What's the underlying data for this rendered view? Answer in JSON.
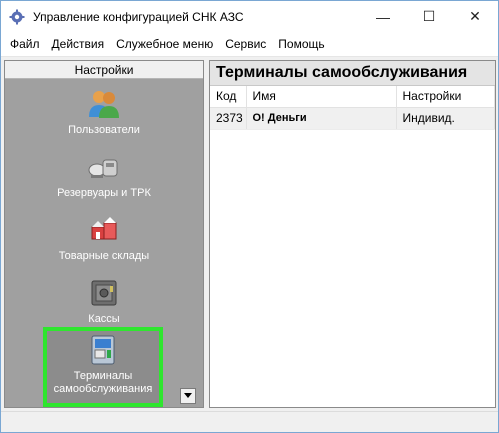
{
  "window": {
    "title": "Управление конфигурацией СНК АЗС",
    "controls": {
      "minimize": "—",
      "maximize": "☐",
      "close": "✕"
    }
  },
  "menu": [
    "Файл",
    "Действия",
    "Служебное меню",
    "Сервис",
    "Помощь"
  ],
  "sidebar": {
    "header": "Настройки",
    "items": [
      {
        "label": "Пользователи",
        "icon": "users-icon"
      },
      {
        "label": "Резервуары и ТРК",
        "icon": "tanks-icon"
      },
      {
        "label": "Товарные склады",
        "icon": "warehouse-icon"
      },
      {
        "label": "Кассы",
        "icon": "cashbox-icon"
      },
      {
        "label": "Терминалы самообслуживания",
        "icon": "terminal-icon",
        "selected": true
      }
    ],
    "highlight_color": "#2ee62e"
  },
  "main": {
    "title": "Терминалы самообслуживания",
    "columns": [
      "Код",
      "Имя",
      "Настройки"
    ],
    "rows": [
      {
        "code": "2373",
        "name": "О! Деньги",
        "settings": "Индивид."
      }
    ]
  }
}
